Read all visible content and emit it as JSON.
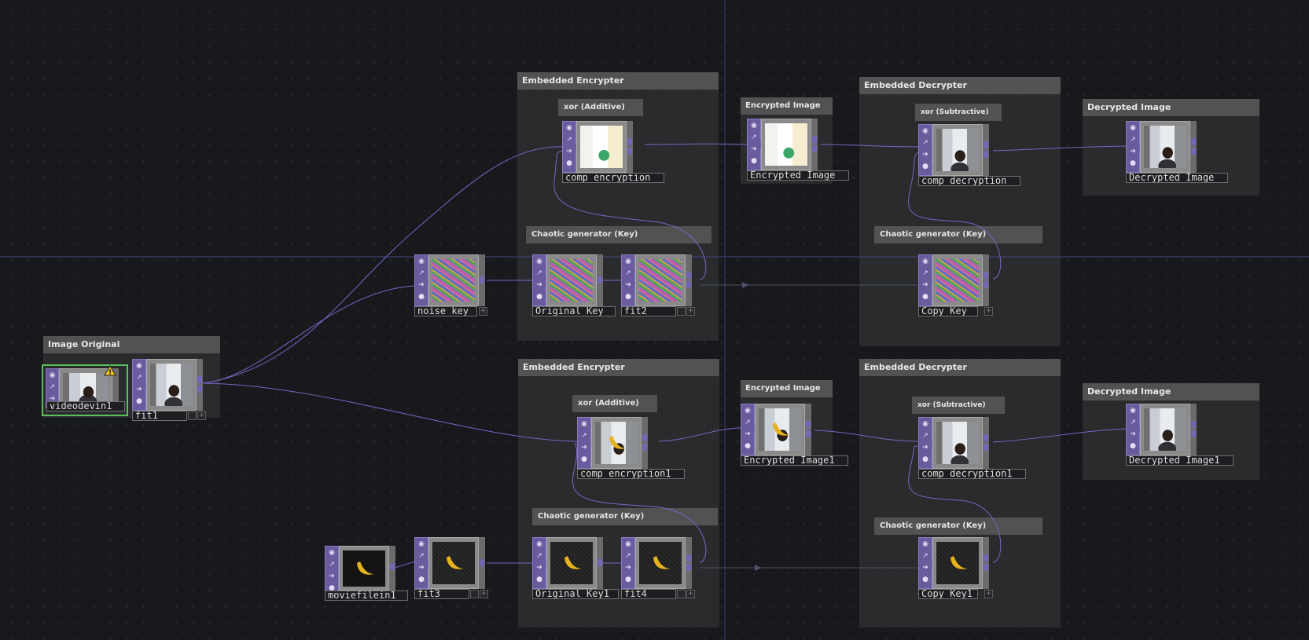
{
  "annotations": {
    "image_original": "Image Original",
    "embedded_encrypter_1": "Embedded Encrypter",
    "embedded_encrypter_2": "Embedded Encrypter",
    "embedded_decrypter_1": "Embedded Decrypter",
    "embedded_decrypter_2": "Embedded Decrypter",
    "xor_additive_1": "xor (Additive)",
    "xor_additive_2": "xor (Additive)",
    "xor_subtractive_1": "xor (Subtractive)",
    "xor_subtractive_2": "xor (Subtractive)",
    "encrypted_image_1": "Encrypted Image",
    "encrypted_image_2": "Encrypted Image",
    "decrypted_image_1": "Decrypted Image",
    "decrypted_image_2": "Decrypted Image",
    "chaotic_key_1": "Chaotic generator (Key)",
    "chaotic_key_2": "Chaotic generator (Key)",
    "chaotic_key_3": "Chaotic generator (Key)",
    "chaotic_key_4": "Chaotic generator (Key)"
  },
  "nodes": {
    "videodevin1": "videodevin1",
    "fit1": "fit1",
    "noise_key": "noise_key",
    "original_key": "Original_Key",
    "fit2": "fit2",
    "comp_encryption": "comp_encryption",
    "encrypted_image": "Encrypted_Image",
    "comp_decryption": "comp_decryption",
    "decrypted_image": "Decrypted_Image",
    "copy_key": "Copy_Key",
    "moviefilein1": "moviefilein1",
    "fit3": "fit3",
    "original_key1": "Original_Key1",
    "fit4": "fit4",
    "comp_encryption1": "comp_encryption1",
    "encrypted_image1": "Encrypted_Image1",
    "comp_decryption1": "comp_decryption1",
    "decrypted_image1": "Decrypted_Image1",
    "copy_key1": "Copy_Key1"
  },
  "icons": {
    "viewer_toggle": "circle-dot-icon",
    "bypass": "pulse-icon",
    "cook": "arrow-right-icon",
    "lock": "lock-icon",
    "warning": "warning-icon",
    "flag_plus": "+"
  },
  "colors": {
    "background": "#18191c",
    "wire": "#7767c7",
    "operator_side": "#6a5a9e",
    "selected_outline": "#5ac25a"
  }
}
